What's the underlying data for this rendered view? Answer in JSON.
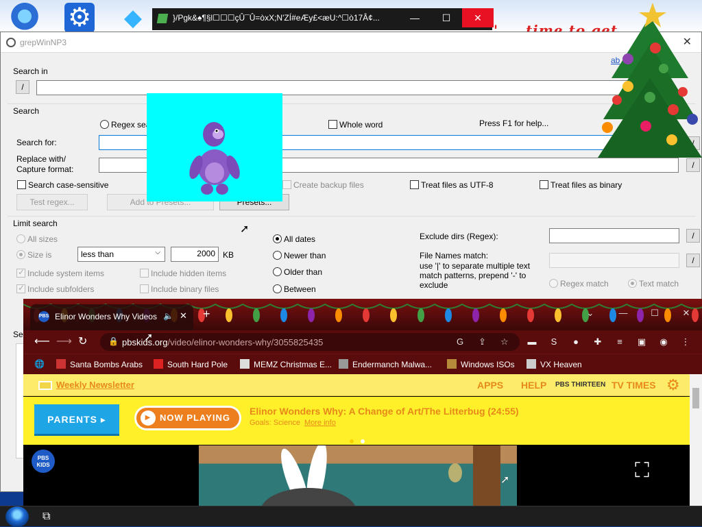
{
  "desktop": {
    "icons": [
      "robot-icon",
      "settings-gear-icon",
      "gem-icon"
    ],
    "banner_text": "' ... time to get ..."
  },
  "mini_window": {
    "title": "}/Pgk&♠¶§l☐☐☐çÛ¯Û=òxX;N'ZÍ#eÆy£<æU:^☐ò17Â¢...",
    "minimize": "—",
    "maximize": "☐",
    "close": "✕"
  },
  "grepwin": {
    "title": "grepWinNP3",
    "close": "✕",
    "about_link": "ab",
    "search_in": {
      "group_label": "Search in",
      "browse_button": "/",
      "path_value": ""
    },
    "search": {
      "group_label": "Search",
      "regex_search_label": "Regex sea",
      "whole_word_label": "Whole word",
      "help_hint": "Press F1 for help...",
      "search_for_label": "Search for:",
      "search_for_value": "",
      "replace_label_1": "Replace with/",
      "replace_label_2": "Capture format:",
      "replace_value": "",
      "replace_browse": "/",
      "search_browse": "/",
      "case_sensitive_label": "Search case-sensitive",
      "create_backup_label": "Create backup files",
      "treat_utf8_label": "Treat files as UTF-8",
      "treat_binary_label": "Treat files as binary",
      "test_regex_button": "Test regex...",
      "add_presets_button": "Add to Presets...",
      "presets_button": "Presets..."
    },
    "limit_search": {
      "group_label": "Limit search",
      "all_sizes_label": "All sizes",
      "size_is_label": "Size is",
      "size_operator": "less than",
      "size_value": "2000",
      "size_unit": "KB",
      "include_system_label": "Include system items",
      "include_hidden_label": "Include hidden items",
      "include_subfolders_label": "Include subfolders",
      "include_binary_label": "Include binary files",
      "all_dates_label": "All dates",
      "newer_than_label": "Newer than",
      "older_than_label": "Older than",
      "between_label": "Between",
      "exclude_dirs_label": "Exclude dirs (Regex):",
      "exclude_dirs_value": "",
      "exclude_dirs_browse": "/",
      "file_names_label": "File Names match:",
      "file_names_hint": "use '|' to separate multiple text match patterns, prepend '-' to exclude",
      "file_names_value": "",
      "file_names_browse": "/",
      "regex_match_label": "Regex match",
      "text_match_label": "Text match"
    },
    "results_group_label": "Se"
  },
  "browser": {
    "tab_title": "Elinor Wonders Why Videos",
    "tab_favicon_text": "PBS",
    "tab_mute": "🔈",
    "tab_close": "✕",
    "new_tab": "+",
    "window_controls": {
      "tab_search": "⌄",
      "minimize": "—",
      "maximize": "☐",
      "close": "✕"
    },
    "url_host": "pbskids.org",
    "url_path": "/video/elinor-wonders-why/3055825435",
    "bookmarks": [
      {
        "label": "Santa Bombs Arabs",
        "icon_color": "#c33"
      },
      {
        "label": "South Hard Pole",
        "icon_color": "#d22"
      },
      {
        "label": "MEMZ Christmas E...",
        "icon_color": "#ddd"
      },
      {
        "label": "Endermanch Malwa...",
        "icon_color": "#999"
      },
      {
        "label": "Windows ISOs",
        "icon_color": "#b58a3a"
      },
      {
        "label": "VX Heaven",
        "icon_color": "#ccc"
      }
    ],
    "page": {
      "newsletter": "Weekly Newsletter",
      "nav_links": [
        "APPS",
        "HELP"
      ],
      "station": "PBS THIRTEEN",
      "tv_times": "TV TIMES",
      "parents_button": "PARENTS ▸",
      "now_playing_button": "NOW PLAYING",
      "now_playing_title": "Elinor Wonders Why: A Change of Art/The Litterbug (24:55)",
      "goals_text": "Goals: Science",
      "more_info": "More info",
      "pbs_kids_logo": "PBS KIDS"
    }
  },
  "colors": {
    "pbs_yellow": "#fff02a",
    "pbs_orange": "#e8891a",
    "pbs_blue": "#1ea5e6",
    "chrome_red": "#5a0c0c",
    "bonzi_bg": "#00ffff"
  }
}
